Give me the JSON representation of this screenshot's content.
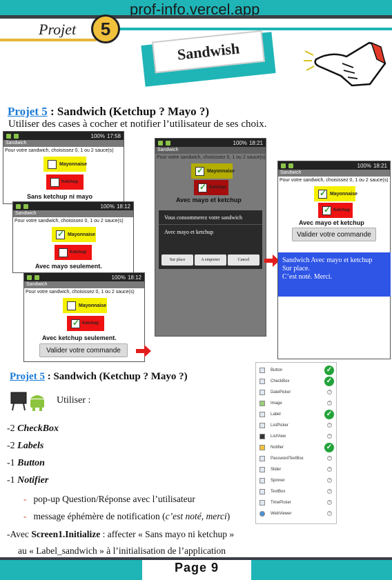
{
  "header": {
    "site": "prof-info.vercel.app",
    "projet_label": "Projet",
    "projet_number": "5",
    "banner": "Sandwish"
  },
  "section1": {
    "link": "Projet 5",
    "title_rest": " : Sandwich (Ketchup ? Mayo ?)",
    "subtitle": "Utiliser des cases à cocher et notifier l’utilisateur de ses choix."
  },
  "phones": {
    "app_title": "Sandwich",
    "prompt": "Pour votre sandwich, choisissez 0, 1 ou 2 sauce(s)",
    "mayo": "Mayonnaise",
    "ketchup": "Ketchup",
    "validate": "Valider votre commande",
    "time1": "17:58",
    "time2": "18:12",
    "time3": "18:12",
    "time4": "18:21",
    "time5": "18:21",
    "battery": "100%",
    "label1": "Sans ketchup ni mayo",
    "label2": "Avec mayo seulement.",
    "label3": "Avec ketchup seulement.",
    "label4": "Avec mayo et ketchup",
    "label5": "Avec mayo et ketchup",
    "dialog_title": "Vous consommerez votre sandwich",
    "dialog_msg": "Avec mayo et ketchup",
    "dialog_btn1": "Sur place",
    "dialog_btn2": "A emporter",
    "dialog_btn3": "Cancel",
    "toast": "Sandwich Avec mayo et ketchup\nSur place.\nC’est noté. Merci."
  },
  "palette": {
    "items": [
      {
        "label": "Button",
        "status": "ok"
      },
      {
        "label": "CheckBox",
        "status": "ok"
      },
      {
        "label": "DatePicker",
        "status": "q"
      },
      {
        "label": "Image",
        "status": "q"
      },
      {
        "label": "Label",
        "status": "ok"
      },
      {
        "label": "ListPicker",
        "status": "q"
      },
      {
        "label": "ListView",
        "status": "q"
      },
      {
        "label": "Notifier",
        "status": "ok"
      },
      {
        "label": "PasswordTextBox",
        "status": "q"
      },
      {
        "label": "Slider",
        "status": "q"
      },
      {
        "label": "Spinner",
        "status": "q"
      },
      {
        "label": "TextBox",
        "status": "q"
      },
      {
        "label": "TimePicker",
        "status": "q"
      },
      {
        "label": "WebViewer",
        "status": "q"
      }
    ]
  },
  "section2": {
    "link": "Projet 5",
    "title_rest": " : Sandwich (Ketchup ? Mayo ?)",
    "utiliser": "Utiliser :",
    "l1_num": "-2 ",
    "l1_item": "CheckBox",
    "l2_num": "-2 ",
    "l2_item": "Labels",
    "l3_num": "-1 ",
    "l3_item": "Button",
    "l4_num": "-1 ",
    "l4_item": "Notifier",
    "sub1": "pop-up Question/Réponse avec l’utilisateur",
    "sub2_a": "message éphémère de notification (",
    "sub2_b": "c’est noté, merci",
    "sub2_c": ")",
    "init_a": "-Avec ",
    "init_b": "Screen1.Initialize",
    "init_c": " :  affecter « Sans mayo ni ketchup »",
    "init_line2": "au « Label_sandwich » à l’initialisation de l’application"
  },
  "footer": {
    "page": "Page 9"
  },
  "colors": {
    "teal": "#1fb5b7",
    "gold": "#f2c13c",
    "link": "#1b7bd6",
    "mayo": "#f5f000",
    "ketchup": "#ee1212",
    "toast": "#2f55e6"
  }
}
